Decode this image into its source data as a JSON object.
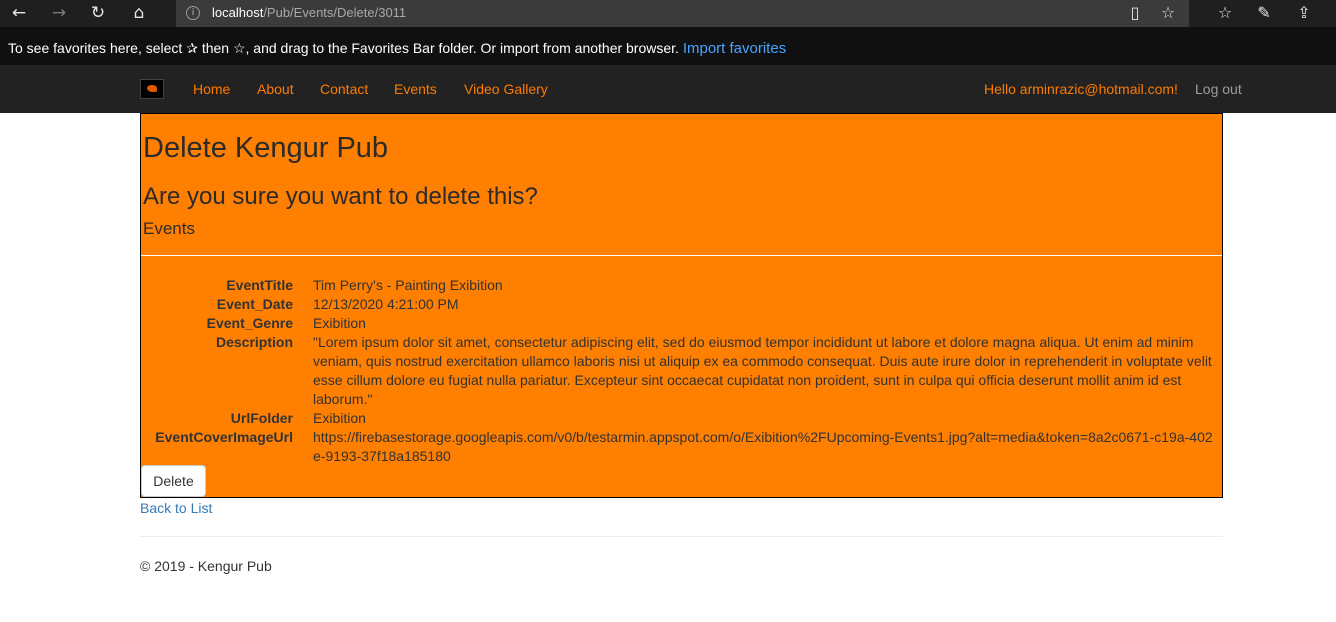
{
  "browser": {
    "url_host": "localhost",
    "url_path": "/Pub/Events/Delete/3011",
    "icons": {
      "back": "←",
      "forward": "→",
      "refresh": "↻",
      "home": "⌂",
      "info": "i",
      "reading_view": "▯",
      "favorite": "☆",
      "favorites_hub": "☆",
      "pen": "✎",
      "share": "⇪"
    }
  },
  "favbar": {
    "message_part1": "To see favorites here, select",
    "star1": "✰",
    "message_part2": "then ☆, and drag to the Favorites Bar folder. Or import from another browser.",
    "import_label": "Import favorites"
  },
  "nav": {
    "links": [
      "Home",
      "About",
      "Contact",
      "Events",
      "Video Gallery"
    ],
    "hello": "Hello arminrazic@hotmail.com!",
    "logout": "Log out"
  },
  "page": {
    "title": "Delete Kengur Pub",
    "question": "Are you sure you want to delete this?",
    "subtitle": "Events",
    "fields": [
      {
        "label": "EventTitle",
        "value": "Tim Perry's - Painting Exibition"
      },
      {
        "label": "Event_Date",
        "value": "12/13/2020 4:21:00 PM"
      },
      {
        "label": "Event_Genre",
        "value": "Exibition"
      },
      {
        "label": "Description",
        "value": "\"Lorem ipsum dolor sit amet, consectetur adipiscing elit, sed do eiusmod tempor incididunt ut labore et dolore magna aliqua. Ut enim ad minim veniam, quis nostrud exercitation ullamco laboris nisi ut aliquip ex ea commodo consequat. Duis aute irure dolor in reprehenderit in voluptate velit esse cillum dolore eu fugiat nulla pariatur. Excepteur sint occaecat cupidatat non proident, sunt in culpa qui officia deserunt mollit anim id est laborum.\""
      },
      {
        "label": "UrlFolder",
        "value": "Exibition"
      },
      {
        "label": "EventCoverImageUrl",
        "value": "https://firebasestorage.googleapis.com/v0/b/testarmin.appspot.com/o/Exibition%2FUpcoming-Events1.jpg?alt=media&token=8a2c0671-c19a-402e-9193-37f18a185180"
      }
    ],
    "delete_label": "Delete",
    "back_label": "Back to List",
    "footer": "© 2019 - Kengur Pub"
  },
  "colors": {
    "accent": "#ff7f00",
    "navbar": "#222222",
    "link": "#337ab7"
  }
}
